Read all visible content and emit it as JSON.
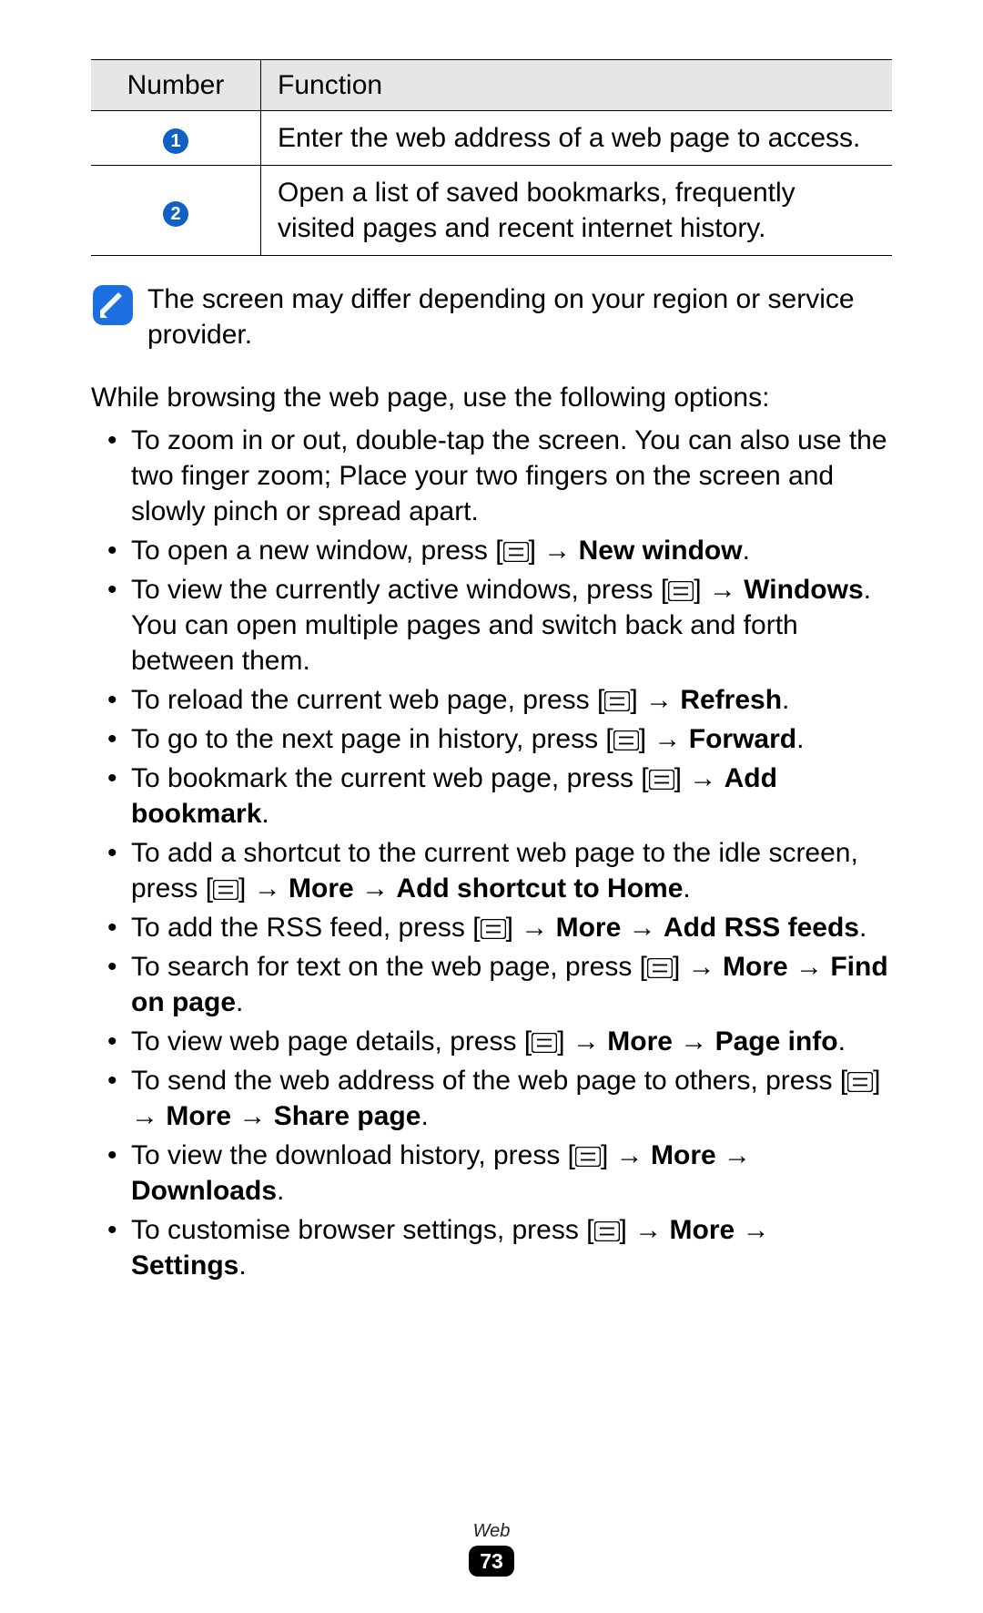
{
  "table": {
    "headers": {
      "number": "Number",
      "function": "Function"
    },
    "rows": [
      {
        "num": "1",
        "func": "Enter the web address of a web page to access."
      },
      {
        "num": "2",
        "func": "Open a list of saved bookmarks, frequently visited pages and recent internet history."
      }
    ]
  },
  "note": {
    "text": "The screen may differ depending on your region or service provider."
  },
  "intro": "While browsing the web page, use the following options:",
  "bullets": {
    "b1_text": "To zoom in or out, double-tap the screen. You can also use the two finger zoom; Place your two fingers on the screen and slowly pinch or spread apart.",
    "b2_pre": "To open a new window, press [",
    "b2_post": "] → ",
    "b2_bold": "New window",
    "b3_pre": "To view the currently active windows, press [",
    "b3_post": "] → ",
    "b3_bold": "Windows",
    "b3_tail": ". You can open multiple pages and switch back and forth between them.",
    "b4_pre": "To reload the current web page, press [",
    "b4_post": "] → ",
    "b4_bold": "Refresh",
    "b5_pre": "To go to the next page in history, press [",
    "b5_post": "] → ",
    "b5_bold": "Forward",
    "b6_pre": "To bookmark the current web page, press [",
    "b6_post": "] → ",
    "b6_bold": "Add bookmark",
    "b7_pre": "To add a shortcut to the current web page to the idle screen, press [",
    "b7_post": "] → ",
    "b7_bold1": "More",
    "b7_mid": " → ",
    "b7_bold2": "Add shortcut to Home",
    "b8_pre": "To add the RSS feed, press [",
    "b8_post": "] → ",
    "b8_bold1": "More",
    "b8_mid": " → ",
    "b8_bold2": "Add RSS feeds",
    "b9_pre": "To search for text on the web page, press [",
    "b9_post": "] → ",
    "b9_bold1": "More",
    "b9_mid": " → ",
    "b9_bold2": "Find on page",
    "b10_pre": "To view web page details, press [",
    "b10_post": "] → ",
    "b10_bold1": "More",
    "b10_mid": " → ",
    "b10_bold2": "Page info",
    "b11_pre": "To send the web address of the web page to others, press [",
    "b11_post": "] → ",
    "b11_bold1": "More",
    "b11_mid": " → ",
    "b11_bold2": "Share page",
    "b12_pre": "To view the download history, press [",
    "b12_post": "] → ",
    "b12_bold1": "More",
    "b12_mid": " → ",
    "b12_bold2": "Downloads",
    "b13_pre": "To customise browser settings, press [",
    "b13_post": "] → ",
    "b13_bold1": "More",
    "b13_mid": " → ",
    "b13_bold2": "Settings"
  },
  "footer": {
    "section": "Web",
    "page": "73"
  },
  "period": "."
}
